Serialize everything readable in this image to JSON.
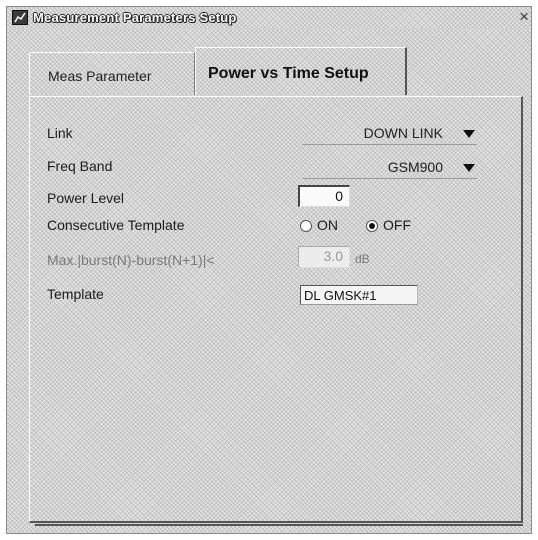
{
  "window": {
    "title": "Measurement Parameters Setup",
    "close_glyph": "×"
  },
  "tabs": [
    {
      "label": "Meas Parameter",
      "active": false
    },
    {
      "label": "Power vs Time Setup",
      "active": true
    }
  ],
  "form": {
    "link": {
      "label": "Link",
      "value": "DOWN LINK"
    },
    "freq_band": {
      "label": "Freq Band",
      "value": "GSM900"
    },
    "power_level": {
      "label": "Power Level",
      "value": "0"
    },
    "consecutive_template": {
      "label": "Consecutive Template",
      "options": [
        {
          "label": "ON",
          "checked": false
        },
        {
          "label": "OFF",
          "checked": true
        }
      ]
    },
    "max_burst": {
      "label": "Max.|burst(N)-burst(N+1)|<",
      "value": "3.0",
      "unit": "dB",
      "enabled": false
    },
    "template": {
      "label": "Template",
      "value": "DL GMSK#1"
    }
  },
  "icons": {
    "title": "measurement-app-icon",
    "close": "close-icon",
    "dropdown": "chevron-down-icon"
  }
}
